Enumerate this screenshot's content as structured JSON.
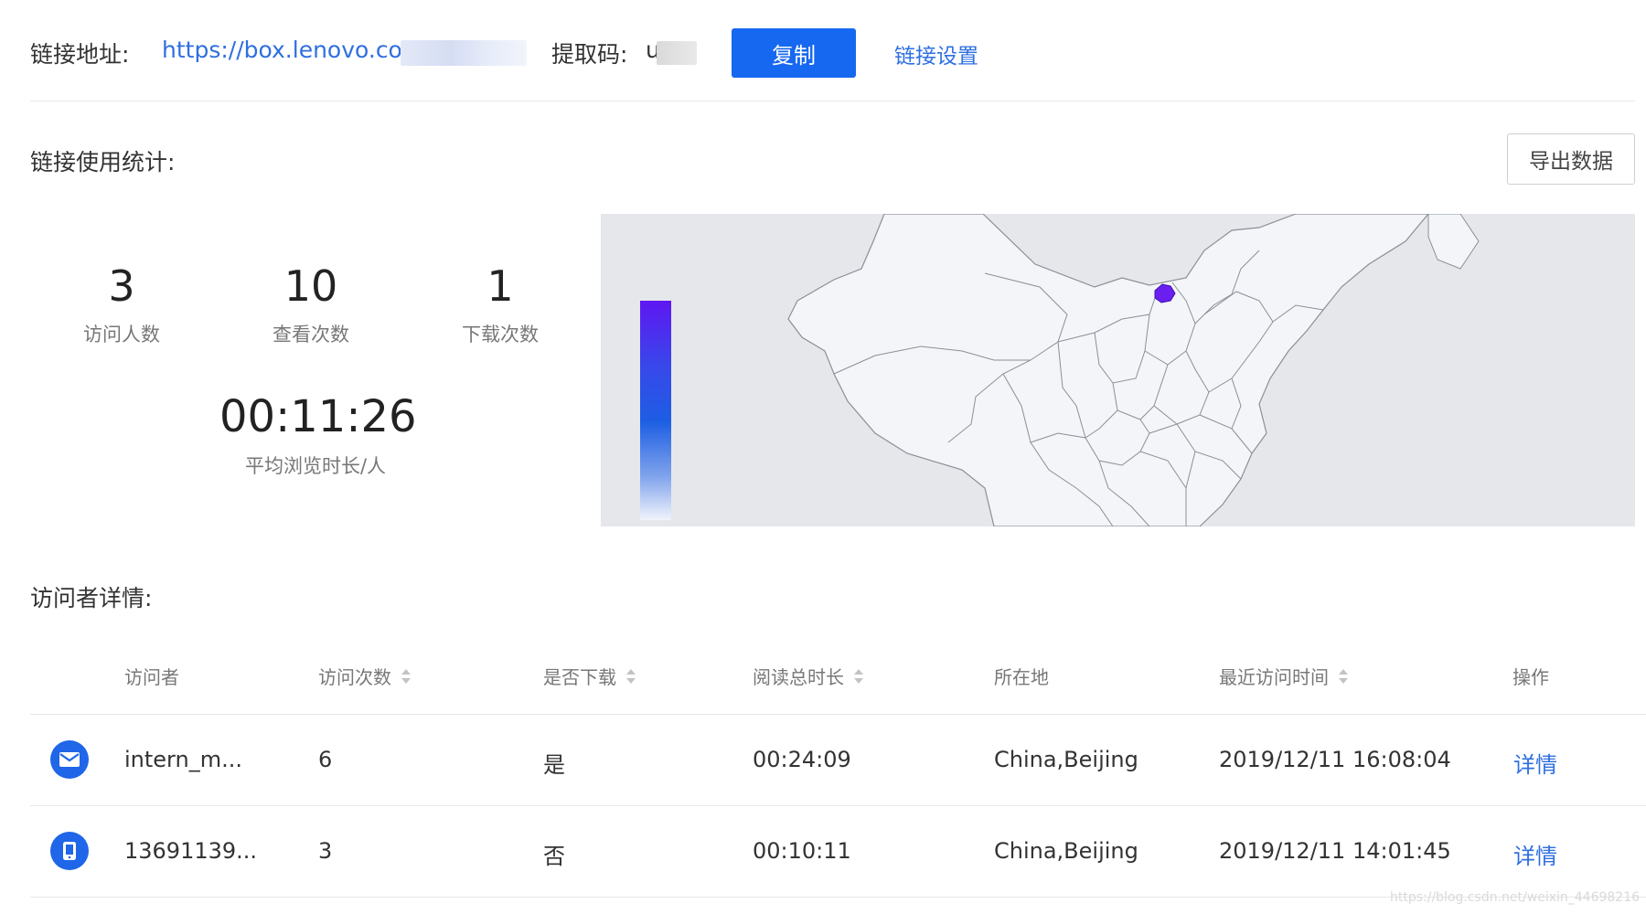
{
  "link_bar": {
    "label": "链接地址:",
    "url": "https://box.lenovo.com",
    "code_label": "提取码:",
    "code_value": "u",
    "copy_button": "复制",
    "settings_link": "链接设置"
  },
  "stats_section": {
    "title": "链接使用统计:",
    "export_button": "导出数据",
    "visitors": {
      "value": "3",
      "label": "访问人数"
    },
    "views": {
      "value": "10",
      "label": "查看次数"
    },
    "downloads": {
      "value": "1",
      "label": "下载次数"
    },
    "avg_duration": {
      "value": "00:11:26",
      "label": "平均浏览时长/人"
    }
  },
  "map": {
    "highlighted_region": "Beijing",
    "highlight_color": "#6a1ff0",
    "legend_colors": [
      "#5f17f2",
      "#1d5ee3",
      "#f1f3fb"
    ]
  },
  "visitor_section": {
    "title": "访问者详情:",
    "columns": [
      "访问者",
      "访问次数",
      "是否下载",
      "阅读总时长",
      "所在地",
      "最近访问时间",
      "操作"
    ],
    "rows": [
      {
        "icon": "mail-icon",
        "visitor": "intern_m...",
        "visits": "6",
        "downloaded": "是",
        "duration": "00:24:09",
        "location": "China,Beijing",
        "last_visit": "2019/12/11 16:08:04",
        "action": "详情"
      },
      {
        "icon": "phone-icon",
        "visitor": "13691139...",
        "visits": "3",
        "downloaded": "否",
        "duration": "00:10:11",
        "location": "China,Beijing",
        "last_visit": "2019/12/11 14:01:45",
        "action": "详情"
      }
    ]
  },
  "watermark": "https://blog.csdn.net/weixin_44698216"
}
